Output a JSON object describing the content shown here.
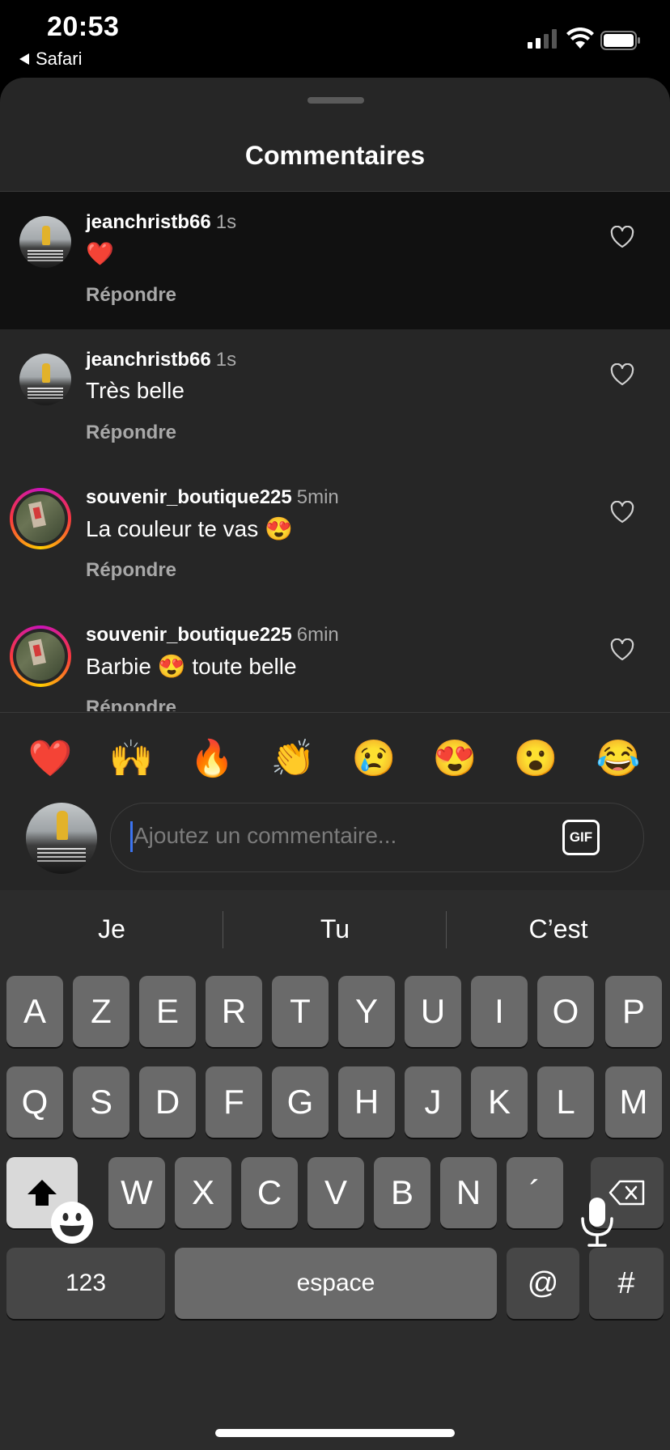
{
  "status_bar": {
    "time": "20:53",
    "back_label": "Safari"
  },
  "sheet": {
    "title": "Commentaires"
  },
  "comments": [
    {
      "user": "jeanchristb66",
      "time": "1s",
      "text": "❤️",
      "reply": "Répondre",
      "avatar": "yellow-coat-photo"
    },
    {
      "user": "jeanchristb66",
      "time": "1s",
      "text": "Très belle",
      "reply": "Répondre",
      "avatar": "yellow-coat-photo"
    },
    {
      "user": "souvenir_boutique225",
      "time": "5min",
      "text": "La couleur te vas 😍",
      "reply": "Répondre",
      "avatar": "story-ring-photo"
    },
    {
      "user": "souvenir_boutique225",
      "time": "6min",
      "text": "Barbie 😍 toute belle",
      "reply": "Répondre",
      "avatar": "story-ring-photo"
    }
  ],
  "quick_emojis": [
    "❤️",
    "🙌",
    "🔥",
    "👏",
    "😢",
    "😍",
    "😮",
    "😂"
  ],
  "composer": {
    "placeholder": "Ajoutez un commentaire...",
    "gif_label": "GIF"
  },
  "keyboard": {
    "suggestions": [
      "Je",
      "Tu",
      "C’est"
    ],
    "row1": [
      "A",
      "Z",
      "E",
      "R",
      "T",
      "Y",
      "U",
      "I",
      "O",
      "P"
    ],
    "row2": [
      "Q",
      "S",
      "D",
      "F",
      "G",
      "H",
      "J",
      "K",
      "L",
      "M"
    ],
    "row3": [
      "W",
      "X",
      "C",
      "V",
      "B",
      "N",
      "´"
    ],
    "numbers_label": "123",
    "space_label": "espace",
    "at_label": "@",
    "hash_label": "#"
  },
  "colors": {
    "background": "#262626",
    "highlight": "#111111",
    "muted_text": "#a8a8a8",
    "caret": "#3c74f0"
  }
}
